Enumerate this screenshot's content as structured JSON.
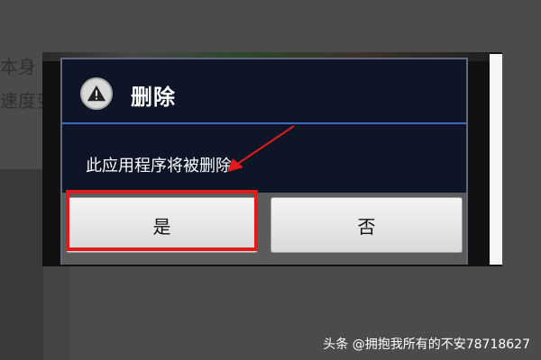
{
  "background": {
    "line1": "本身",
    "line2": "速度变"
  },
  "dialog": {
    "title": "删除",
    "message": "此应用程序将被删除",
    "confirm_label": "是",
    "cancel_label": "否"
  },
  "icons": {
    "warning": "warning-icon"
  },
  "watermark": "头条 @拥抱我所有的不安78718627",
  "colors": {
    "dialog_bg": "#0d1526",
    "title_divider": "#3b6cc4",
    "highlight": "#e11b1b"
  }
}
